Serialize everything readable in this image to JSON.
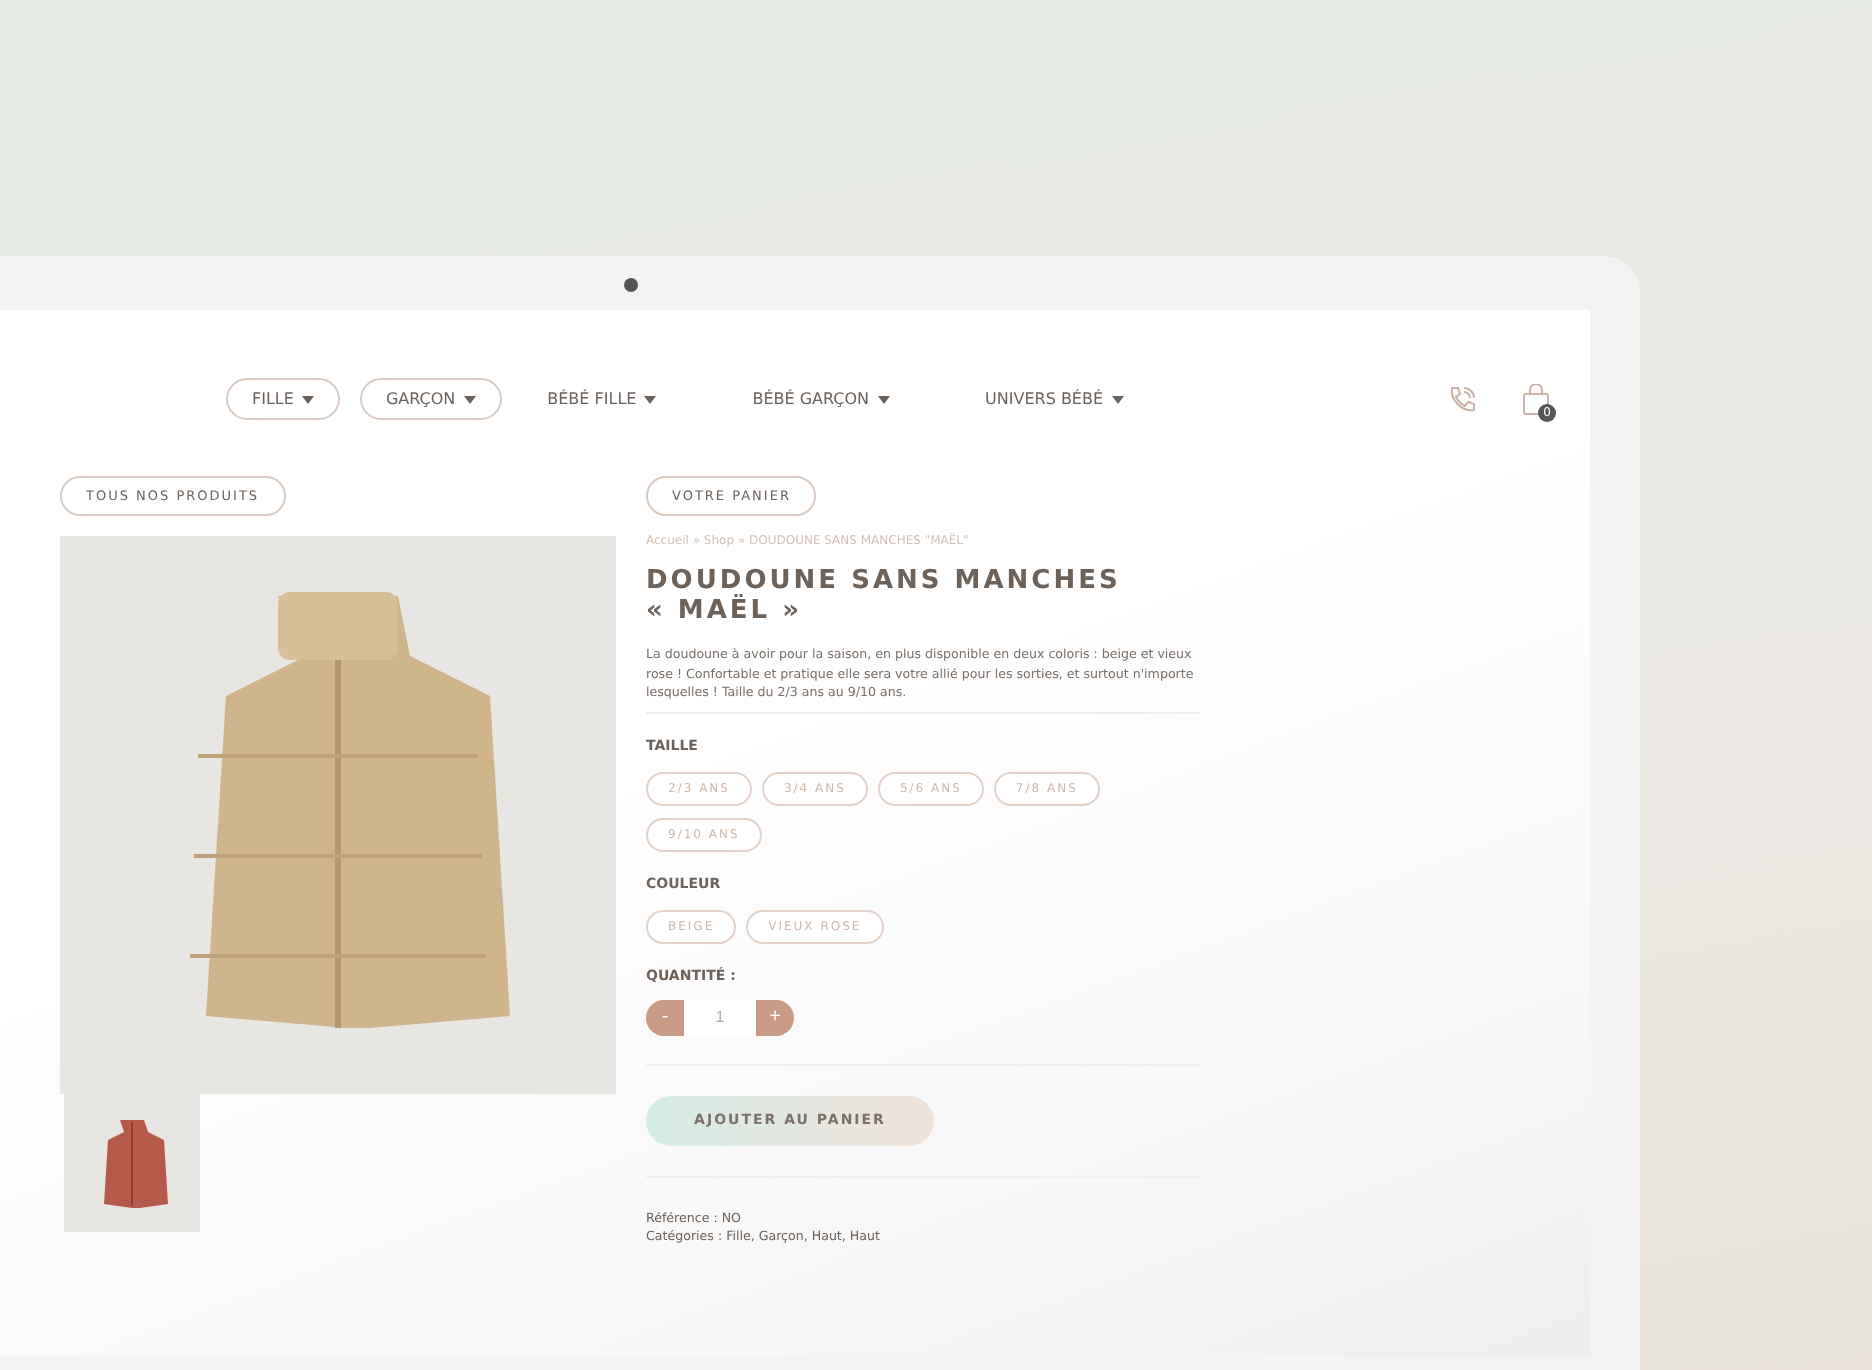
{
  "nav": {
    "items": [
      {
        "label": "FILLE",
        "outlined": true
      },
      {
        "label": "GARÇON",
        "outlined": true
      },
      {
        "label": "BÉBÉ FILLE",
        "outlined": false
      },
      {
        "label": "BÉBÉ GARÇON",
        "outlined": false
      },
      {
        "label": "UNIVERS BÉBÉ",
        "outlined": false
      }
    ],
    "cart_count": "0"
  },
  "left": {
    "button": "TOUS NOS PRODUITS"
  },
  "product": {
    "cart_button": "VOTRE PANIER",
    "breadcrumb": "Accueil » Shop » DOUDOUNE SANS MANCHES \"MAËL\"",
    "title_lines": [
      "DOUDOUNE SANS MANCHES",
      "« MAËL »"
    ],
    "description": "La doudoune à avoir pour la saison, en plus disponible en deux coloris : beige et vieux rose ! Confortable et pratique elle sera votre allié pour les sorties, et surtout n'importe lesquelles ! Taille du 2/3 ans au 9/10 ans.",
    "size_label": "TAILLE",
    "sizes": [
      {
        "label": "2/3 ANS",
        "selected": false
      },
      {
        "label": "3/4 ANS",
        "selected": false
      },
      {
        "label": "5/6 ANS",
        "selected": false
      },
      {
        "label": "7/8 ANS",
        "selected": false
      },
      {
        "label": "9/10 ANS",
        "selected": false
      }
    ],
    "color_label": "COULEUR",
    "colors": [
      {
        "label": "BEIGE",
        "selected": false
      },
      {
        "label": "VIEUX ROSE",
        "selected": false
      }
    ],
    "quantity_label": "QUANTITÉ :",
    "quantity": {
      "minus": "-",
      "value": "1",
      "plus": "+"
    },
    "add_button": {
      "label": "AJOUTER AU PANIER",
      "disabled": true
    },
    "meta": [
      "Référence : NO",
      "Catégories : Fille, Garçon, Haut, Haut"
    ]
  }
}
